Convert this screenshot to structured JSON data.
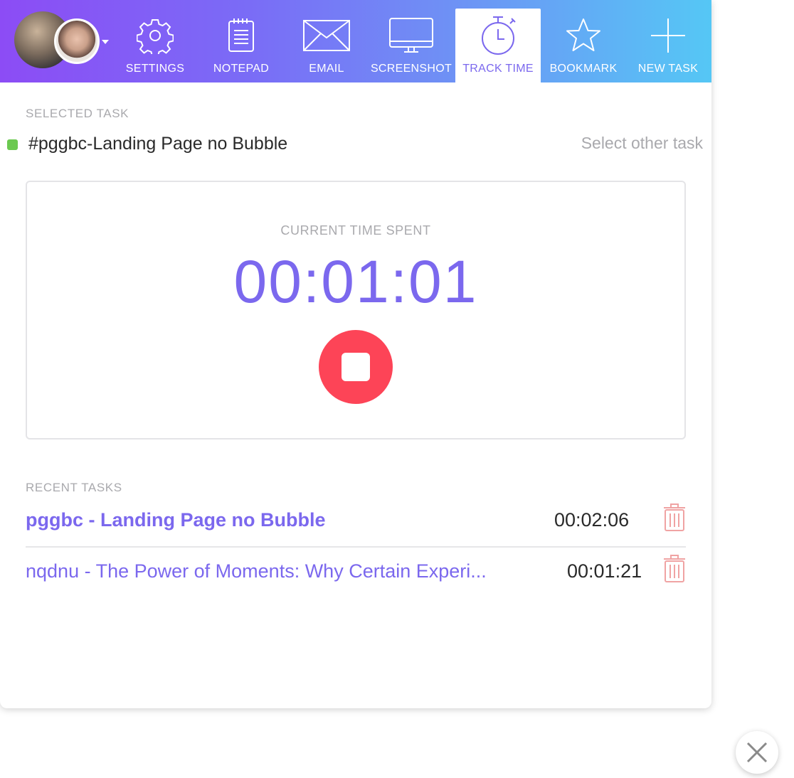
{
  "toolbar": {
    "tools": [
      {
        "label": "SETTINGS",
        "icon": "gear-icon"
      },
      {
        "label": "NOTEPAD",
        "icon": "notepad-icon"
      },
      {
        "label": "EMAIL",
        "icon": "envelope-icon"
      },
      {
        "label": "SCREENSHOT",
        "icon": "monitor-icon"
      },
      {
        "label": "TRACK TIME",
        "icon": "stopwatch-icon",
        "active": true
      },
      {
        "label": "BOOKMARK",
        "icon": "star-icon"
      },
      {
        "label": "NEW TASK",
        "icon": "plus-icon"
      }
    ]
  },
  "selected": {
    "label": "SELECTED TASK",
    "task_name": "#pggbc-Landing Page no Bubble",
    "status_color": "#6bc950",
    "other_link": "Select other task"
  },
  "timer": {
    "caption": "CURRENT TIME SPENT",
    "value": "00:01:01",
    "stop_color": "#fd4457"
  },
  "recent": {
    "label": "RECENT TASKS",
    "items": [
      {
        "name": "pggbc - Landing Page no Bubble",
        "time": "00:02:06"
      },
      {
        "name": "nqdnu - The Power of Moments: Why Certain Experi...",
        "time": "00:01:21"
      }
    ]
  },
  "colors": {
    "accent": "#7b68ee",
    "gradient_start": "#8c4cf5",
    "gradient_end": "#55c7f5",
    "trash": "#f0a3a3"
  }
}
